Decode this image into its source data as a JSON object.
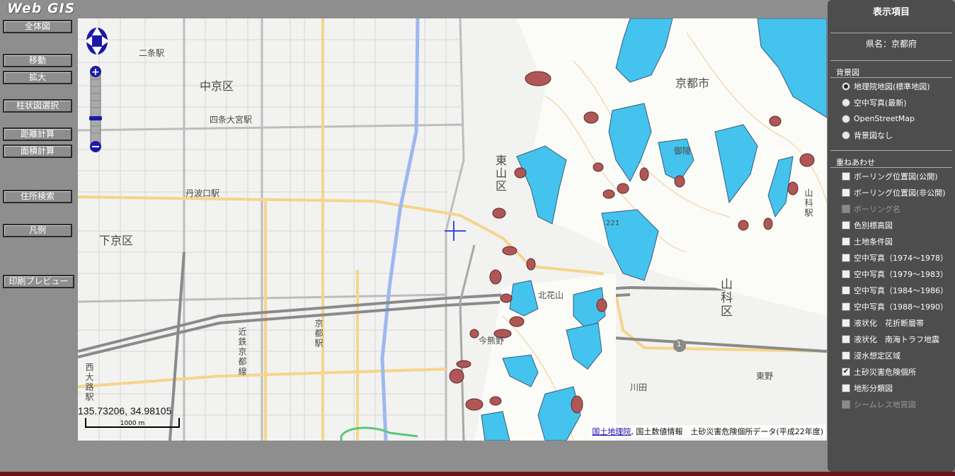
{
  "app": {
    "title": "Web GIS"
  },
  "toolbar": {
    "buttons": [
      {
        "id": "full",
        "label": "全体図"
      },
      {
        "id": "move",
        "label": "移動"
      },
      {
        "id": "zoom",
        "label": "拡大"
      },
      {
        "id": "column",
        "label": "柱状図選択"
      },
      {
        "id": "distance",
        "label": "距離計算"
      },
      {
        "id": "area",
        "label": "面積計算"
      },
      {
        "id": "address",
        "label": "住所検索"
      },
      {
        "id": "legend",
        "label": "凡例"
      },
      {
        "id": "print",
        "label": "印刷プレビュー"
      }
    ]
  },
  "map": {
    "labels": {
      "nijo_station": "二条駅",
      "nakagyo": "中京区",
      "shijo_omiya": "四条大宮駅",
      "tanbaguchi": "丹波口駅",
      "shimogyo": "下京区",
      "kyoto_city": "京都市",
      "higashiyama": "東山区",
      "yamashina_ku": "山科区",
      "yamashina_eki": "山科駅",
      "kitakazan": "北花山",
      "imagumano": "今熊野",
      "kintetsu_kyoto": "近鉄京都線",
      "kyoto_station": "京都駅",
      "nishioji": "西大路駅",
      "kawata": "川田",
      "higashino": "東野",
      "misasagi": "御陵",
      "route1": "1",
      "elev": "221"
    },
    "coords": "135.73206, 34.98105",
    "scale_label": "1000 m",
    "attribution": {
      "link": "国土地理院",
      "text": ", 国土数値情報　土砂災害危険個所データ(平成22年度)"
    },
    "colors": {
      "danger_area": "#44c3ee",
      "danger_spot": "#b05656",
      "main_road": "#f6d48c",
      "river": "#9db8ef"
    }
  },
  "panel": {
    "title": "表示項目",
    "prefecture": "県名：京都府",
    "background_section": "背景図",
    "background_options": [
      {
        "label": "地理院地図(標準地図)",
        "selected": true
      },
      {
        "label": "空中写真(最新)",
        "selected": false
      },
      {
        "label": "OpenStreetMap",
        "selected": false
      },
      {
        "label": "背景図なし",
        "selected": false
      }
    ],
    "overlay_section": "重ねあわせ",
    "overlay_options": [
      {
        "label": "ボーリング位置図(公開)",
        "checked": false,
        "enabled": true
      },
      {
        "label": "ボーリング位置図(非公開)",
        "checked": false,
        "enabled": true
      },
      {
        "label": "ボーリング名",
        "checked": false,
        "enabled": false
      },
      {
        "label": "色別標高図",
        "checked": false,
        "enabled": true
      },
      {
        "label": "土地条件図",
        "checked": false,
        "enabled": true
      },
      {
        "label": "空中写真（1974～1978）",
        "checked": false,
        "enabled": true
      },
      {
        "label": "空中写真（1979～1983）",
        "checked": false,
        "enabled": true
      },
      {
        "label": "空中写真（1984～1986）",
        "checked": false,
        "enabled": true
      },
      {
        "label": "空中写真（1988～1990）",
        "checked": false,
        "enabled": true
      },
      {
        "label": "液状化　花折断層帯",
        "checked": false,
        "enabled": true
      },
      {
        "label": "液状化　南海トラフ地震",
        "checked": false,
        "enabled": true
      },
      {
        "label": "浸水想定区域",
        "checked": false,
        "enabled": true
      },
      {
        "label": "土砂災害危険個所",
        "checked": true,
        "enabled": true
      },
      {
        "label": "地形分類図",
        "checked": false,
        "enabled": true
      },
      {
        "label": "シームレス地質図",
        "checked": false,
        "enabled": false
      }
    ]
  }
}
